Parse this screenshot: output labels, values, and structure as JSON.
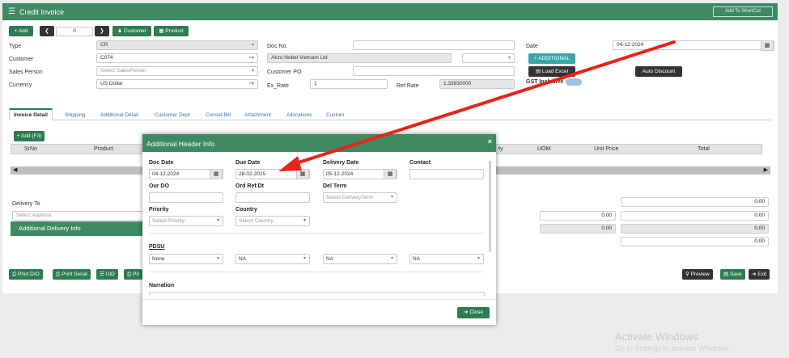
{
  "app": {
    "title": "Credit Invoice",
    "menu_icon": "hamburger-icon",
    "shortcut_label": "Add To ShortCut"
  },
  "toolbar": {
    "add_label": "+ Add",
    "record_number": "0",
    "customer_label": "Customer",
    "product_label": "Product"
  },
  "form": {
    "type_label": "Type",
    "type_value": "CR",
    "customer_label": "Customer",
    "customer_value": "C074",
    "sales_person_label": "Sales Person",
    "sales_person_placeholder": "Select SalesPerson",
    "currency_label": "Currency",
    "currency_value": "US Dollar",
    "doc_no_label": "Doc No.",
    "customer_name": "Akzo Nobel Vietnam Ltd",
    "customer_po_label": "Customer PO",
    "ex_rate_label": "Ex_Rate",
    "ex_rate_value": "1",
    "ref_rate_label": "Ref Rate",
    "ref_rate_value": "1.33930000",
    "date_label": "Date",
    "date_value": "04-12-2024",
    "additional_button": "+ ADDITIONAL",
    "load_excel_button": "Load Excel",
    "gst_label": "GST Inclusive",
    "auto_discount_button": "Auto Discount"
  },
  "tabs": [
    "Invoice Detail",
    "Shipping",
    "Additional Detail",
    "Customer Dept",
    "Consol-Bill",
    "Attachment",
    "Allocations",
    "Custom"
  ],
  "detail": {
    "add_f3": "+ Add (F3)",
    "columns": [
      "SrNo",
      "Product",
      "ty",
      "UOM",
      "Unit Price",
      "Total"
    ],
    "delivery_to_label": "Delivery To",
    "select_address": "Select Address",
    "additional_delivery_info": "Additional Delivery Info",
    "totals": [
      "0.00",
      "0.00",
      "0.00",
      "0.00",
      "0.00"
    ],
    "mid_totals": [
      "0.00",
      "0.00"
    ]
  },
  "bottom_buttons": [
    "Print D/O",
    "Print Serial",
    "UID",
    "Pri"
  ],
  "right_buttons": {
    "preview": "Preview",
    "save": "Save",
    "exit": "Exit"
  },
  "modal": {
    "title": "Additional Header Info",
    "doc_date_label": "Doc Date",
    "doc_date_value": "04-12-2024",
    "due_date_label": "Due Date",
    "due_date_value": "28-02-2025",
    "delivery_date_label": "Delivery Date",
    "delivery_date_value": "05-12-2024",
    "contact_label": "Contact",
    "our_do_label": "Our DO",
    "ord_ref_label": "Ord Ref.Dt",
    "del_term_label": "Del Term",
    "del_term_placeholder": "Select DeliveryTerm",
    "priority_label": "Priority",
    "priority_placeholder": "Select Priority",
    "country_label": "Country",
    "country_placeholder": "Select Country",
    "pdsu_label": "PDSU",
    "pdsu_values": [
      "None",
      "NA",
      "NA",
      "NA"
    ],
    "narration_label": "Narration",
    "close_button": "Close"
  },
  "watermark": {
    "line1": "Activate Windows",
    "line2": "Go to Settings to activate Windows."
  },
  "annotation_color": "#e8231a"
}
